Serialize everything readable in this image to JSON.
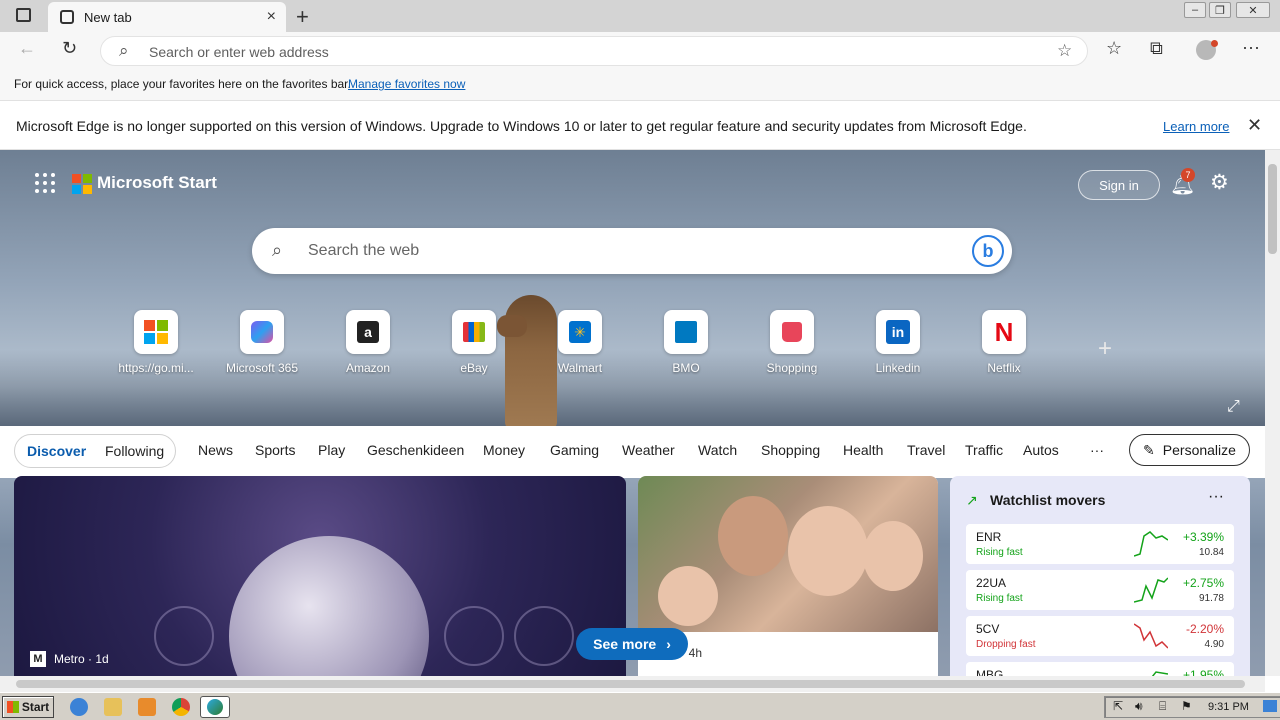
{
  "browser": {
    "tab_title": "New tab",
    "address_placeholder": "Search or enter web address",
    "favorites_bar": {
      "text": "For quick access, place your favorites here on the favorites bar.",
      "link": "Manage favorites now"
    },
    "infobar": {
      "message": "Microsoft Edge is no longer supported on this version of Windows. Upgrade to Windows 10 or later to get regular feature and security updates from Microsoft Edge.",
      "link": "Learn more"
    }
  },
  "start": {
    "brand": "Microsoft Start",
    "sign_in": "Sign in",
    "notification_count": "7",
    "search_placeholder": "Search the web",
    "tiles": [
      {
        "label": "https://go.mi..."
      },
      {
        "label": "Microsoft 365"
      },
      {
        "label": "Amazon"
      },
      {
        "label": "eBay"
      },
      {
        "label": "Walmart"
      },
      {
        "label": "BMO"
      },
      {
        "label": "Shopping"
      },
      {
        "label": "Linkedin"
      },
      {
        "label": "Netflix"
      }
    ],
    "feed_tabs": {
      "discover": "Discover",
      "following": "Following"
    },
    "nav": [
      "News",
      "Sports",
      "Play",
      "Geschenkideen",
      "Money",
      "Gaming",
      "Weather",
      "Watch",
      "Shopping",
      "Health",
      "Travel",
      "Traffic",
      "Autos",
      "···"
    ],
    "personalize": "Personalize",
    "main_card": {
      "source": "Metro · 1d"
    },
    "see_more": "See more",
    "card2": {
      "source": "CNN · 4h"
    },
    "watchlist": {
      "title": "Watchlist movers",
      "rows": [
        {
          "symbol": "ENR",
          "tag": "Rising fast",
          "change": "+3.39%",
          "price": "10.84",
          "color": "#14a31a"
        },
        {
          "symbol": "22UA",
          "tag": "Rising fast",
          "change": "+2.75%",
          "price": "91.78",
          "color": "#14a31a"
        },
        {
          "symbol": "5CV",
          "tag": "Dropping fast",
          "change": "-2.20%",
          "price": "4.90",
          "color": "#d13438"
        },
        {
          "symbol": "MBG",
          "tag": "",
          "change": "+1.95%",
          "price": "",
          "color": "#14a31a"
        }
      ]
    }
  },
  "taskbar": {
    "start": "Start",
    "time": "9:31 PM"
  }
}
